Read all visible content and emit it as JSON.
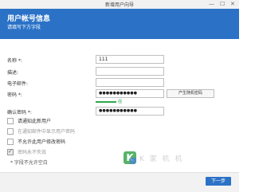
{
  "window": {
    "title": "新增用户向导",
    "controls": [
      "—",
      "☐",
      "✕"
    ]
  },
  "header": {
    "title": "用户帐号信息",
    "subtitle": "请填写下方字段"
  },
  "form": {
    "name_label": "名称",
    "name_req": " *:",
    "name_value": "111",
    "desc_label": "描述:",
    "desc_value": "",
    "email_label": "电子邮件:",
    "email_value": "",
    "password_label": "密码",
    "password_req": " *:",
    "password_value": "●●●●●●●●●●●",
    "generate_button": "产生随机密码",
    "strength_text": "强",
    "confirm_label": "确认密码",
    "confirm_req": " *:",
    "confirm_value": "●●●●●●●●●●●"
  },
  "options": [
    {
      "label": "请通知此新用户",
      "checked": false,
      "muted": false
    },
    {
      "label": "在通知邮件中显示用户密码",
      "checked": false,
      "muted": true
    },
    {
      "label": "不允许此用户修改密码",
      "checked": false,
      "muted": false
    },
    {
      "label": "密码永不失效",
      "checked": true,
      "muted": true
    }
  ],
  "footnote": "* 字段不允许空白",
  "next_button": "下一步",
  "watermark_text": "K 家 机 机"
}
